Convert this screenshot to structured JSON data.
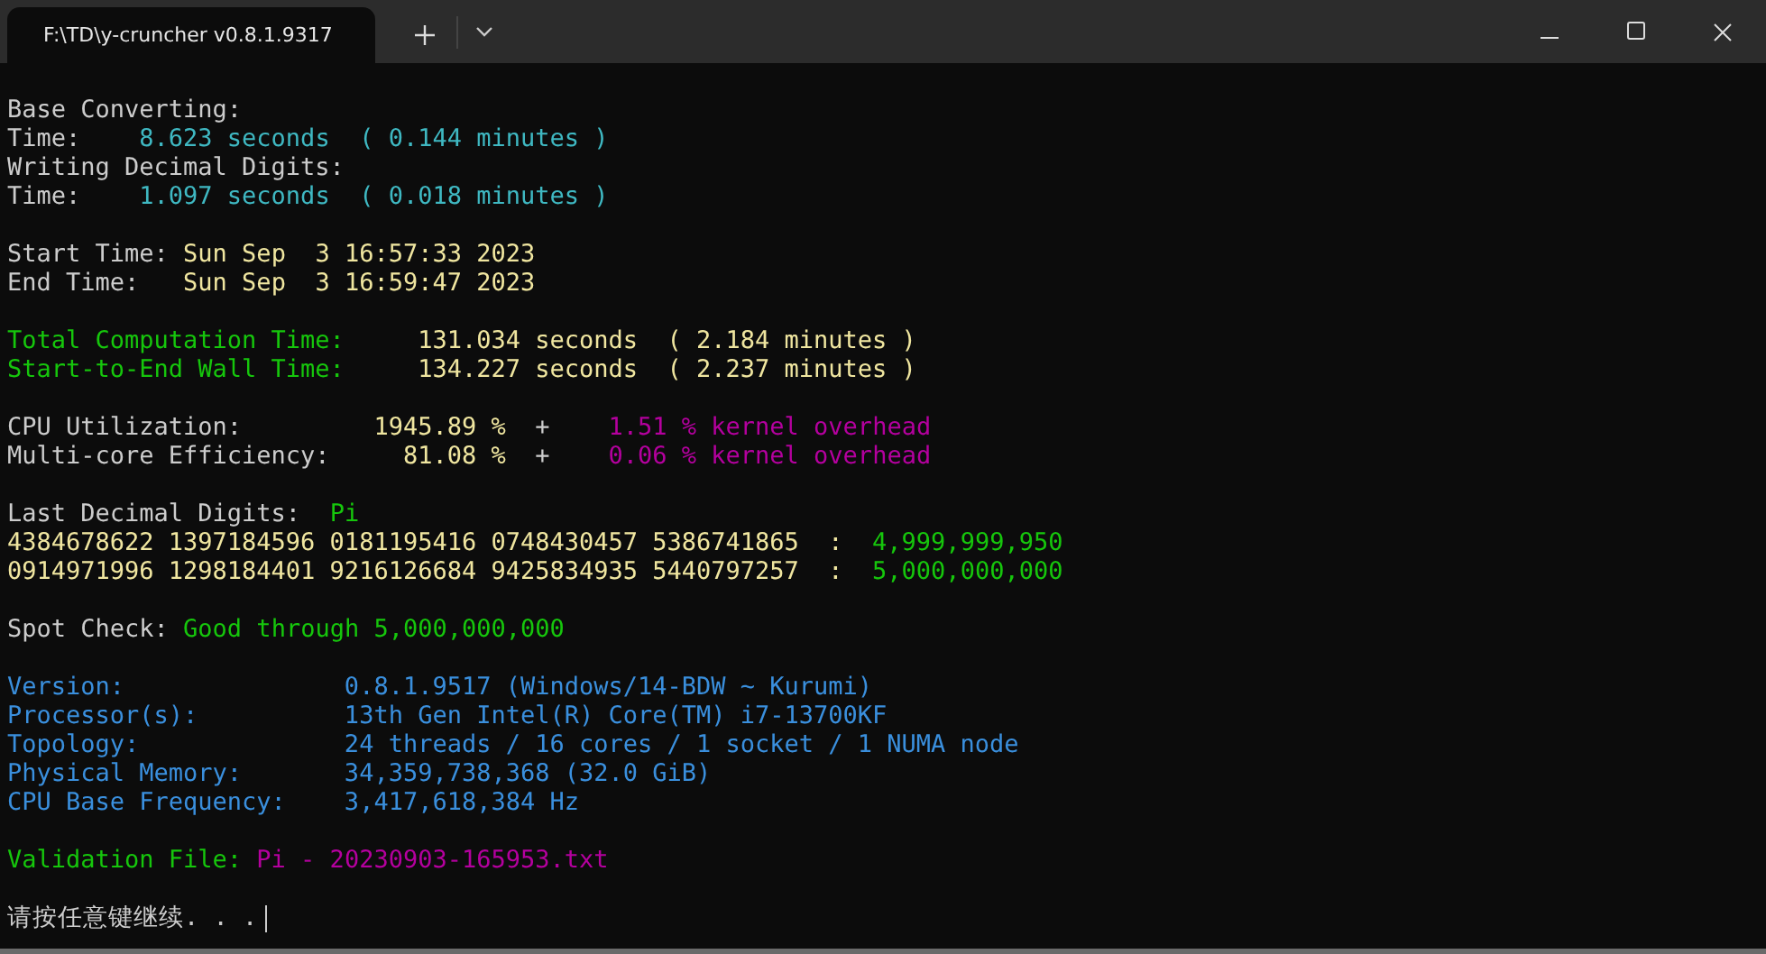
{
  "window": {
    "tab_title": "F:\\TD\\y-cruncher v0.8.1.9317",
    "tab_selected": true
  },
  "terminal": {
    "lines": [
      {
        "kind": "text",
        "segments": [
          {
            "text": "Base Converting:",
            "color": "#cccccc"
          }
        ]
      },
      {
        "kind": "text",
        "segments": [
          {
            "text": "Time:    ",
            "color": "#cccccc"
          },
          {
            "text": "8.623 seconds  ( 0.144 minutes )",
            "color": "#3fb8c2"
          }
        ]
      },
      {
        "kind": "text",
        "segments": [
          {
            "text": "Writing Decimal Digits:",
            "color": "#cccccc"
          }
        ]
      },
      {
        "kind": "text",
        "segments": [
          {
            "text": "Time:    ",
            "color": "#cccccc"
          },
          {
            "text": "1.097 seconds  ( 0.018 minutes )",
            "color": "#3fb8c2"
          }
        ]
      },
      {
        "kind": "blank"
      },
      {
        "kind": "text",
        "segments": [
          {
            "text": "Start Time: ",
            "color": "#cccccc"
          },
          {
            "text": "Sun Sep  3 16:57:33 2023",
            "color": "#f0e6a0"
          }
        ]
      },
      {
        "kind": "text",
        "segments": [
          {
            "text": "End Time:   ",
            "color": "#cccccc"
          },
          {
            "text": "Sun Sep  3 16:59:47 2023",
            "color": "#f0e6a0"
          }
        ]
      },
      {
        "kind": "blank"
      },
      {
        "kind": "text",
        "segments": [
          {
            "text": "Total Computation Time:     ",
            "color": "#16c60c"
          },
          {
            "text": "131.034 seconds  ( 2.184 minutes )",
            "color": "#f0e6a0"
          }
        ]
      },
      {
        "kind": "text",
        "segments": [
          {
            "text": "Start-to-End Wall Time:     ",
            "color": "#16c60c"
          },
          {
            "text": "134.227 seconds  ( 2.237 minutes )",
            "color": "#f0e6a0"
          }
        ]
      },
      {
        "kind": "blank"
      },
      {
        "kind": "text",
        "segments": [
          {
            "text": "CPU Utilization:         ",
            "color": "#cccccc"
          },
          {
            "text": "1945.89 %",
            "color": "#f0e6a0"
          },
          {
            "text": "  +    ",
            "color": "#cccccc"
          },
          {
            "text": "1.51 % kernel overhead",
            "color": "#b4009e"
          }
        ]
      },
      {
        "kind": "text",
        "segments": [
          {
            "text": "Multi-core Efficiency:     ",
            "color": "#cccccc"
          },
          {
            "text": "81.08 %",
            "color": "#f0e6a0"
          },
          {
            "text": "  +    ",
            "color": "#cccccc"
          },
          {
            "text": "0.06 % kernel overhead",
            "color": "#b4009e"
          }
        ]
      },
      {
        "kind": "blank"
      },
      {
        "kind": "text",
        "segments": [
          {
            "text": "Last Decimal Digits:  ",
            "color": "#cccccc"
          },
          {
            "text": "Pi",
            "color": "#16c60c"
          }
        ]
      },
      {
        "kind": "text",
        "segments": [
          {
            "text": "4384678622 1397184596 0181195416 0748430457 5386741865  :  ",
            "color": "#f0e6a0"
          },
          {
            "text": "4,999,999,950",
            "color": "#16c60c"
          }
        ]
      },
      {
        "kind": "text",
        "segments": [
          {
            "text": "0914971996 1298184401 9216126684 9425834935 5440797257  :  ",
            "color": "#f0e6a0"
          },
          {
            "text": "5,000,000,000",
            "color": "#16c60c"
          }
        ]
      },
      {
        "kind": "blank"
      },
      {
        "kind": "text",
        "segments": [
          {
            "text": "Spot Check: ",
            "color": "#cccccc"
          },
          {
            "text": "Good through 5,000,000,000",
            "color": "#16c60c"
          }
        ]
      },
      {
        "kind": "blank"
      },
      {
        "kind": "text",
        "segments": [
          {
            "text": "Version:               0.8.1.9517 (Windows/14-BDW ~ Kurumi)",
            "color": "#3a8fdd"
          }
        ]
      },
      {
        "kind": "text",
        "segments": [
          {
            "text": "Processor(s):          13th Gen Intel(R) Core(TM) i7-13700KF",
            "color": "#3a8fdd"
          }
        ]
      },
      {
        "kind": "text",
        "segments": [
          {
            "text": "Topology:              24 threads / 16 cores / 1 socket / 1 NUMA node",
            "color": "#3a8fdd"
          }
        ]
      },
      {
        "kind": "text",
        "segments": [
          {
            "text": "Physical Memory:       34,359,738,368 (32.0 GiB)",
            "color": "#3a8fdd"
          }
        ]
      },
      {
        "kind": "text",
        "segments": [
          {
            "text": "CPU Base Frequency:    3,417,618,384 Hz",
            "color": "#3a8fdd"
          }
        ]
      },
      {
        "kind": "blank"
      },
      {
        "kind": "text",
        "segments": [
          {
            "text": "Validation File: ",
            "color": "#16c60c"
          },
          {
            "text": "Pi - 20230903-165953.txt",
            "color": "#b4009e"
          }
        ]
      },
      {
        "kind": "blank"
      },
      {
        "kind": "prompt",
        "segments": [
          {
            "text": "请按任意键继续. . .",
            "color": "#cccccc"
          }
        ]
      }
    ]
  }
}
